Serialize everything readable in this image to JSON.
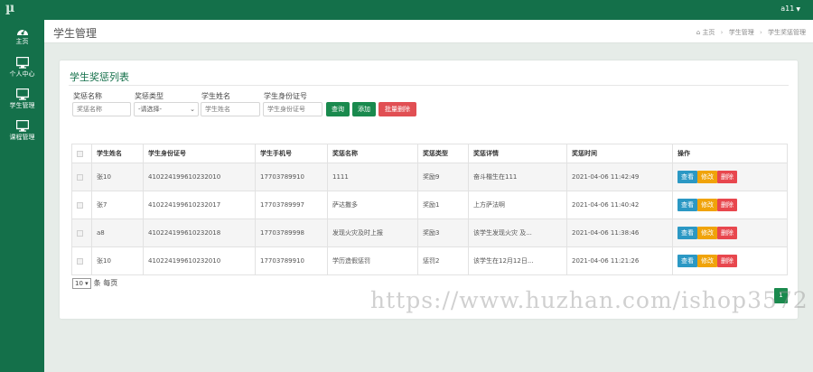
{
  "app": {
    "logo": "µ",
    "user": "a11",
    "colors": {
      "primary": "#14704a",
      "button_green": "#1a8a4e",
      "button_red": "#e14f53",
      "view": "#2b98c4",
      "edit": "#f0a30a",
      "delete": "#e8474e"
    }
  },
  "sidebar": {
    "items": [
      {
        "label": "主页",
        "icon": "dashboard-icon"
      },
      {
        "label": "个人中心",
        "icon": "monitor-icon"
      },
      {
        "label": "学生管理",
        "icon": "monitor-icon"
      },
      {
        "label": "课程管理",
        "icon": "monitor-icon"
      }
    ]
  },
  "header": {
    "title": "学生管理",
    "breadcrumb": [
      "主页",
      "学生管理",
      "学生奖惩管理"
    ]
  },
  "panel": {
    "title": "学生奖惩列表"
  },
  "search": {
    "fields": [
      {
        "label": "奖惩名称",
        "placeholder": "奖惩名称"
      },
      {
        "label": "奖惩类型",
        "value": "-请选择-"
      },
      {
        "label": "学生姓名",
        "placeholder": "学生姓名"
      },
      {
        "label": "学生身份证号",
        "placeholder": "学生身份证号"
      }
    ],
    "buttons": {
      "query": "查询",
      "add": "添加",
      "batch_delete": "批量删除"
    }
  },
  "table": {
    "headers": [
      "学生姓名",
      "学生身份证号",
      "学生手机号",
      "奖惩名称",
      "奖惩类型",
      "奖惩详情",
      "奖惩时间",
      "操作"
    ],
    "rows": [
      {
        "name": "张10",
        "id_card": "410224199610232010",
        "phone": "17703789910",
        "title": "1111",
        "type": "奖励9",
        "detail": "奋斗楷生在111",
        "time": "2021-04-06 11:42:49"
      },
      {
        "name": "张7",
        "id_card": "410224199610232017",
        "phone": "17703789997",
        "title": "萨达撒多",
        "type": "奖励1",
        "detail": "上方萨法啊",
        "time": "2021-04-06 11:40:42"
      },
      {
        "name": "a8",
        "id_card": "410224199610232018",
        "phone": "17703789998",
        "title": "发现火灾及时上报",
        "type": "奖励3",
        "detail": "该学生发现火灾 及...",
        "time": "2021-04-06 11:38:46"
      },
      {
        "name": "张10",
        "id_card": "410224199610232010",
        "phone": "17703789910",
        "title": "学历造假惩罚",
        "type": "惩罚2",
        "detail": "该学生在12月12日...",
        "time": "2021-04-06 11:21:26"
      }
    ],
    "actions": {
      "view": "查看",
      "edit": "修改",
      "delete": "删除"
    }
  },
  "pagination": {
    "page_size": "10",
    "page_size_suffix": "条 每页",
    "current_page": "1"
  },
  "watermark": "https://www.huzhan.com/ishop3572"
}
